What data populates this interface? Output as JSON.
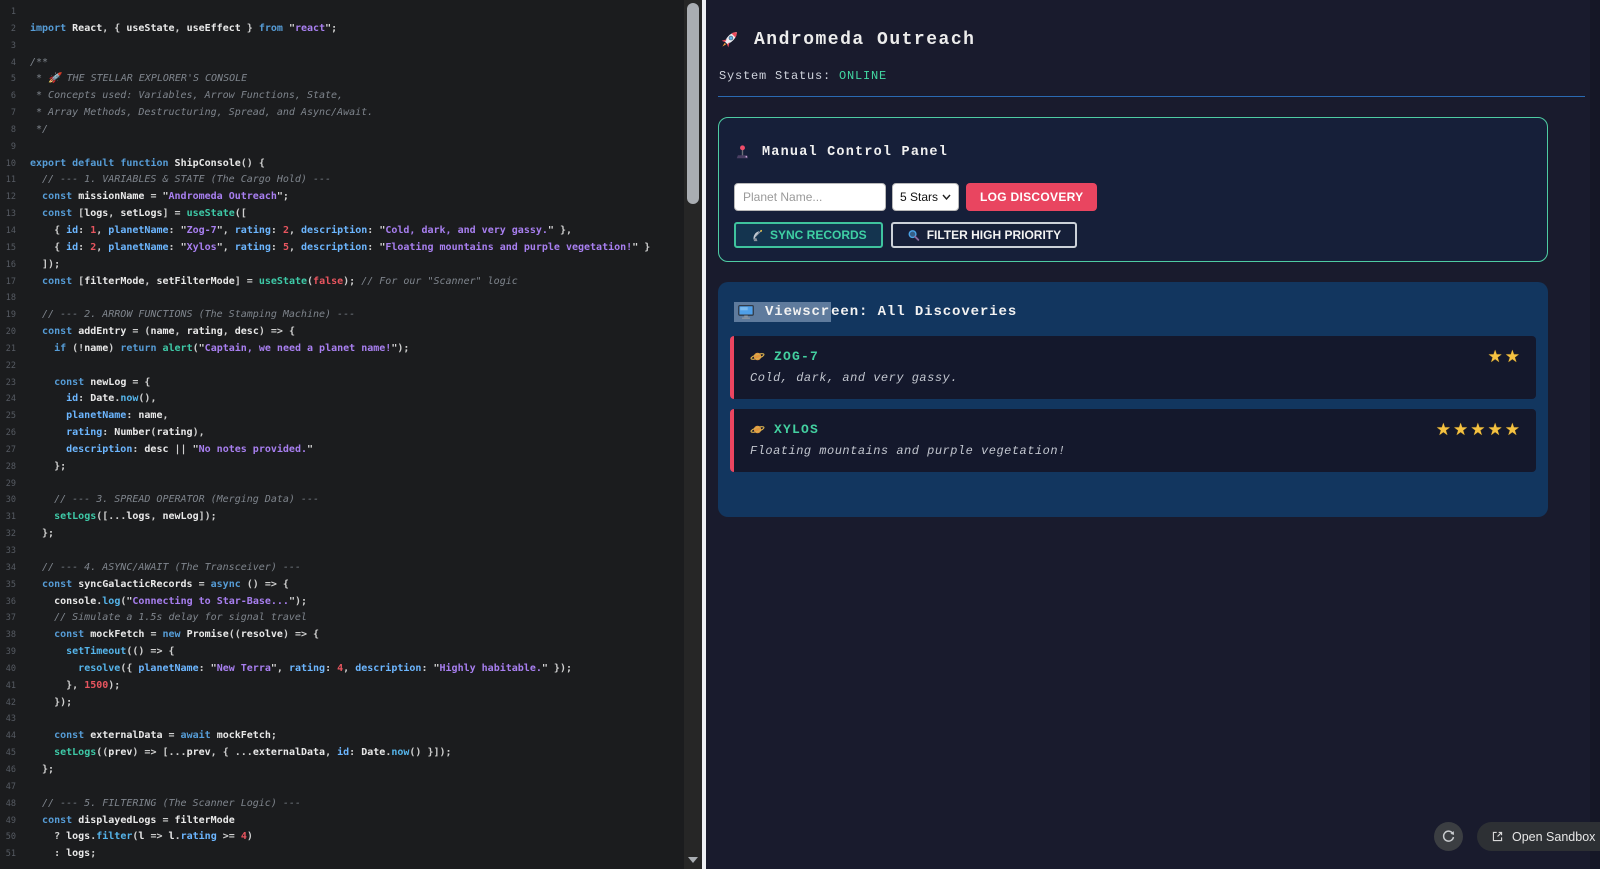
{
  "colors": {
    "editor_bg": "#1b1c1e",
    "preview_bg": "#191b2d",
    "panel_bg": "#161f39",
    "teal_accent": "#4ecca3",
    "pink_accent": "#e94560",
    "viewscreen_bg": "#12365f",
    "card_bg": "#14182c",
    "star_gold": "#f5c242",
    "online_green": "#43d9a3",
    "hr_blue": "#2a6ab2"
  },
  "editor": {
    "lines": [
      [],
      [
        [
          "kw",
          "import"
        ],
        [
          "pln",
          " "
        ],
        [
          "id",
          "React"
        ],
        [
          "pln",
          ", { "
        ],
        [
          "id",
          "useState"
        ],
        [
          "pln",
          ", "
        ],
        [
          "id",
          "useEffect"
        ],
        [
          "pln",
          " } "
        ],
        [
          "kw",
          "from"
        ],
        [
          "pln",
          " "
        ],
        [
          "q",
          "\""
        ],
        [
          "str",
          "react"
        ],
        [
          "q",
          "\""
        ],
        [
          "pln",
          ";"
        ]
      ],
      [],
      [
        [
          "cmt",
          "/**"
        ]
      ],
      [
        [
          "cmt",
          " * 🚀 THE STELLAR EXPLORER'S CONSOLE"
        ]
      ],
      [
        [
          "cmt",
          " * Concepts used: Variables, Arrow Functions, State,"
        ]
      ],
      [
        [
          "cmt",
          " * Array Methods, Destructuring, Spread, and Async/Await."
        ]
      ],
      [
        [
          "cmt",
          " */"
        ]
      ],
      [],
      [
        [
          "kw",
          "export"
        ],
        [
          "pln",
          " "
        ],
        [
          "kw",
          "default"
        ],
        [
          "pln",
          " "
        ],
        [
          "kw",
          "function"
        ],
        [
          "pln",
          " "
        ],
        [
          "id",
          "ShipConsole"
        ],
        [
          "pln",
          "() {"
        ]
      ],
      [
        [
          "cmt",
          "  // --- 1. VARIABLES & STATE (The Cargo Hold) ---"
        ]
      ],
      [
        [
          "pln",
          "  "
        ],
        [
          "kw",
          "const"
        ],
        [
          "pln",
          " "
        ],
        [
          "id",
          "missionName"
        ],
        [
          "pln",
          " = "
        ],
        [
          "q",
          "\""
        ],
        [
          "str",
          "Andromeda Outreach"
        ],
        [
          "q",
          "\""
        ],
        [
          "pln",
          ";"
        ]
      ],
      [
        [
          "pln",
          "  "
        ],
        [
          "kw",
          "const"
        ],
        [
          "pln",
          " ["
        ],
        [
          "id",
          "logs"
        ],
        [
          "pln",
          ", "
        ],
        [
          "id",
          "setLogs"
        ],
        [
          "pln",
          "] = "
        ],
        [
          "fn",
          "useState"
        ],
        [
          "pln",
          "(["
        ]
      ],
      [
        [
          "pln",
          "    { "
        ],
        [
          "prop",
          "id"
        ],
        [
          "pln",
          ": "
        ],
        [
          "num",
          "1"
        ],
        [
          "pln",
          ", "
        ],
        [
          "prop",
          "planetName"
        ],
        [
          "pln",
          ": "
        ],
        [
          "q",
          "\""
        ],
        [
          "str",
          "Zog-7"
        ],
        [
          "q",
          "\""
        ],
        [
          "pln",
          ", "
        ],
        [
          "prop",
          "rating"
        ],
        [
          "pln",
          ": "
        ],
        [
          "num",
          "2"
        ],
        [
          "pln",
          ", "
        ],
        [
          "prop",
          "description"
        ],
        [
          "pln",
          ": "
        ],
        [
          "q",
          "\""
        ],
        [
          "str",
          "Cold, dark, and very gassy."
        ],
        [
          "q",
          "\""
        ],
        [
          "pln",
          " },"
        ]
      ],
      [
        [
          "pln",
          "    { "
        ],
        [
          "prop",
          "id"
        ],
        [
          "pln",
          ": "
        ],
        [
          "num",
          "2"
        ],
        [
          "pln",
          ", "
        ],
        [
          "prop",
          "planetName"
        ],
        [
          "pln",
          ": "
        ],
        [
          "q",
          "\""
        ],
        [
          "str",
          "Xylos"
        ],
        [
          "q",
          "\""
        ],
        [
          "pln",
          ", "
        ],
        [
          "prop",
          "rating"
        ],
        [
          "pln",
          ": "
        ],
        [
          "num",
          "5"
        ],
        [
          "pln",
          ", "
        ],
        [
          "prop",
          "description"
        ],
        [
          "pln",
          ": "
        ],
        [
          "q",
          "\""
        ],
        [
          "str",
          "Floating mountains and purple vegetation!"
        ],
        [
          "q",
          "\""
        ],
        [
          "pln",
          " }"
        ]
      ],
      [
        [
          "pln",
          "  ]);"
        ]
      ],
      [
        [
          "pln",
          "  "
        ],
        [
          "kw",
          "const"
        ],
        [
          "pln",
          " ["
        ],
        [
          "id",
          "filterMode"
        ],
        [
          "pln",
          ", "
        ],
        [
          "id",
          "setFilterMode"
        ],
        [
          "pln",
          "] = "
        ],
        [
          "fn",
          "useState"
        ],
        [
          "pln",
          "("
        ],
        [
          "num",
          "false"
        ],
        [
          "pln",
          "); "
        ],
        [
          "cmt",
          "// For our \"Scanner\" logic"
        ]
      ],
      [],
      [
        [
          "cmt",
          "  // --- 2. ARROW FUNCTIONS (The Stamping Machine) ---"
        ]
      ],
      [
        [
          "pln",
          "  "
        ],
        [
          "kw",
          "const"
        ],
        [
          "pln",
          " "
        ],
        [
          "id",
          "addEntry"
        ],
        [
          "pln",
          " = ("
        ],
        [
          "id",
          "name"
        ],
        [
          "pln",
          ", "
        ],
        [
          "id",
          "rating"
        ],
        [
          "pln",
          ", "
        ],
        [
          "id",
          "desc"
        ],
        [
          "pln",
          ") => {"
        ]
      ],
      [
        [
          "pln",
          "    "
        ],
        [
          "kw",
          "if"
        ],
        [
          "pln",
          " (!"
        ],
        [
          "id",
          "name"
        ],
        [
          "pln",
          ") "
        ],
        [
          "kw",
          "return"
        ],
        [
          "pln",
          " "
        ],
        [
          "fn",
          "alert"
        ],
        [
          "pln",
          "("
        ],
        [
          "q",
          "\""
        ],
        [
          "str",
          "Captain, we need a planet name!"
        ],
        [
          "q",
          "\""
        ],
        [
          "pln",
          ");"
        ]
      ],
      [],
      [
        [
          "pln",
          "    "
        ],
        [
          "kw",
          "const"
        ],
        [
          "pln",
          " "
        ],
        [
          "id",
          "newLog"
        ],
        [
          "pln",
          " = {"
        ]
      ],
      [
        [
          "pln",
          "      "
        ],
        [
          "prop",
          "id"
        ],
        [
          "pln",
          ": "
        ],
        [
          "id",
          "Date"
        ],
        [
          "pln",
          "."
        ],
        [
          "m",
          "now"
        ],
        [
          "pln",
          "(),"
        ]
      ],
      [
        [
          "pln",
          "      "
        ],
        [
          "prop",
          "planetName"
        ],
        [
          "pln",
          ": "
        ],
        [
          "id",
          "name"
        ],
        [
          "pln",
          ","
        ]
      ],
      [
        [
          "pln",
          "      "
        ],
        [
          "prop",
          "rating"
        ],
        [
          "pln",
          ": "
        ],
        [
          "id",
          "Number"
        ],
        [
          "pln",
          "("
        ],
        [
          "id",
          "rating"
        ],
        [
          "pln",
          "),"
        ]
      ],
      [
        [
          "pln",
          "      "
        ],
        [
          "prop",
          "description"
        ],
        [
          "pln",
          ": "
        ],
        [
          "id",
          "desc"
        ],
        [
          "pln",
          " || "
        ],
        [
          "q",
          "\""
        ],
        [
          "str",
          "No notes provided."
        ],
        [
          "q",
          "\""
        ]
      ],
      [
        [
          "pln",
          "    };"
        ]
      ],
      [],
      [
        [
          "cmt",
          "    // --- 3. SPREAD OPERATOR (Merging Data) ---"
        ]
      ],
      [
        [
          "pln",
          "    "
        ],
        [
          "fn",
          "setLogs"
        ],
        [
          "pln",
          "([..."
        ],
        [
          "id",
          "logs"
        ],
        [
          "pln",
          ", "
        ],
        [
          "id",
          "newLog"
        ],
        [
          "pln",
          "]);"
        ]
      ],
      [
        [
          "pln",
          "  };"
        ]
      ],
      [],
      [
        [
          "cmt",
          "  // --- 4. ASYNC/AWAIT (The Transceiver) ---"
        ]
      ],
      [
        [
          "pln",
          "  "
        ],
        [
          "kw",
          "const"
        ],
        [
          "pln",
          " "
        ],
        [
          "id",
          "syncGalacticRecords"
        ],
        [
          "pln",
          " = "
        ],
        [
          "kw",
          "async"
        ],
        [
          "pln",
          " () => {"
        ]
      ],
      [
        [
          "pln",
          "    "
        ],
        [
          "id",
          "console"
        ],
        [
          "pln",
          "."
        ],
        [
          "m",
          "log"
        ],
        [
          "pln",
          "("
        ],
        [
          "q",
          "\""
        ],
        [
          "str",
          "Connecting to Star-Base..."
        ],
        [
          "q",
          "\""
        ],
        [
          "pln",
          ");"
        ]
      ],
      [
        [
          "cmt",
          "    // Simulate a 1.5s delay for signal travel"
        ]
      ],
      [
        [
          "pln",
          "    "
        ],
        [
          "kw",
          "const"
        ],
        [
          "pln",
          " "
        ],
        [
          "id",
          "mockFetch"
        ],
        [
          "pln",
          " = "
        ],
        [
          "kw",
          "new"
        ],
        [
          "pln",
          " "
        ],
        [
          "id",
          "Promise"
        ],
        [
          "pln",
          "(("
        ],
        [
          "id",
          "resolve"
        ],
        [
          "pln",
          ") => {"
        ]
      ],
      [
        [
          "pln",
          "      "
        ],
        [
          "m",
          "setTimeout"
        ],
        [
          "pln",
          "(() => {"
        ]
      ],
      [
        [
          "pln",
          "        "
        ],
        [
          "m",
          "resolve"
        ],
        [
          "pln",
          "({ "
        ],
        [
          "prop",
          "planetName"
        ],
        [
          "pln",
          ": "
        ],
        [
          "q",
          "\""
        ],
        [
          "str",
          "New Terra"
        ],
        [
          "q",
          "\""
        ],
        [
          "pln",
          ", "
        ],
        [
          "prop",
          "rating"
        ],
        [
          "pln",
          ": "
        ],
        [
          "num",
          "4"
        ],
        [
          "pln",
          ", "
        ],
        [
          "prop",
          "description"
        ],
        [
          "pln",
          ": "
        ],
        [
          "q",
          "\""
        ],
        [
          "str",
          "Highly habitable."
        ],
        [
          "q",
          "\""
        ],
        [
          "pln",
          " });"
        ]
      ],
      [
        [
          "pln",
          "      }, "
        ],
        [
          "num",
          "1500"
        ],
        [
          "pln",
          ");"
        ]
      ],
      [
        [
          "pln",
          "    });"
        ]
      ],
      [],
      [
        [
          "pln",
          "    "
        ],
        [
          "kw",
          "const"
        ],
        [
          "pln",
          " "
        ],
        [
          "id",
          "externalData"
        ],
        [
          "pln",
          " = "
        ],
        [
          "kw",
          "await"
        ],
        [
          "pln",
          " "
        ],
        [
          "id",
          "mockFetch"
        ],
        [
          "pln",
          ";"
        ]
      ],
      [
        [
          "pln",
          "    "
        ],
        [
          "fn",
          "setLogs"
        ],
        [
          "pln",
          "(("
        ],
        [
          "id",
          "prev"
        ],
        [
          "pln",
          ") => [..."
        ],
        [
          "id",
          "prev"
        ],
        [
          "pln",
          ", { ..."
        ],
        [
          "id",
          "externalData"
        ],
        [
          "pln",
          ", "
        ],
        [
          "prop",
          "id"
        ],
        [
          "pln",
          ": "
        ],
        [
          "id",
          "Date"
        ],
        [
          "pln",
          "."
        ],
        [
          "m",
          "now"
        ],
        [
          "pln",
          "() }]);"
        ]
      ],
      [
        [
          "pln",
          "  };"
        ]
      ],
      [],
      [
        [
          "cmt",
          "  // --- 5. FILTERING (The Scanner Logic) ---"
        ]
      ],
      [
        [
          "pln",
          "  "
        ],
        [
          "kw",
          "const"
        ],
        [
          "pln",
          " "
        ],
        [
          "id",
          "displayedLogs"
        ],
        [
          "pln",
          " = "
        ],
        [
          "id",
          "filterMode"
        ]
      ],
      [
        [
          "pln",
          "    ? "
        ],
        [
          "id",
          "logs"
        ],
        [
          "pln",
          "."
        ],
        [
          "m",
          "filter"
        ],
        [
          "pln",
          "("
        ],
        [
          "id",
          "l"
        ],
        [
          "pln",
          " => "
        ],
        [
          "id",
          "l"
        ],
        [
          "pln",
          "."
        ],
        [
          "prop",
          "rating"
        ],
        [
          "pln",
          " >= "
        ],
        [
          "num",
          "4"
        ],
        [
          "pln",
          ")"
        ]
      ],
      [
        [
          "pln",
          "    : "
        ],
        [
          "id",
          "logs"
        ],
        [
          "pln",
          ";"
        ]
      ]
    ]
  },
  "preview": {
    "title": "Andromeda Outreach",
    "title_icon": "rocket-icon",
    "status_label": "System Status: ",
    "status_value": "ONLINE",
    "control_panel": {
      "heading": "Manual Control Panel",
      "heading_icon": "joystick-icon",
      "planet_input_placeholder": "Planet Name...",
      "rating_select_value": "5 Stars",
      "log_button_label": "LOG DISCOVERY",
      "sync_button_label": "SYNC RECORDS",
      "sync_button_icon": "satellite-dish-icon",
      "filter_button_label": "FILTER HIGH PRIORITY",
      "filter_button_icon": "magnifier-icon"
    },
    "viewscreen": {
      "heading_full": "Viewscreen: All Discoveries",
      "heading_selected_part": "Viewscr",
      "heading_rest_part": "een: All Discoveries",
      "heading_icon": "monitor-icon",
      "cards": [
        {
          "icon": "ringed-planet-icon",
          "name": "ZOG-7",
          "description": "Cold, dark, and very gassy.",
          "rating": 2,
          "stars": "★★"
        },
        {
          "icon": "ringed-planet-icon",
          "name": "XYLOS",
          "description": "Floating mountains and purple vegetation!",
          "rating": 5,
          "stars": "★★★★★"
        }
      ]
    },
    "footer": {
      "refresh_icon": "refresh-icon",
      "open_sandbox_icon": "external-link-icon",
      "open_sandbox_label": "Open Sandbox"
    }
  }
}
